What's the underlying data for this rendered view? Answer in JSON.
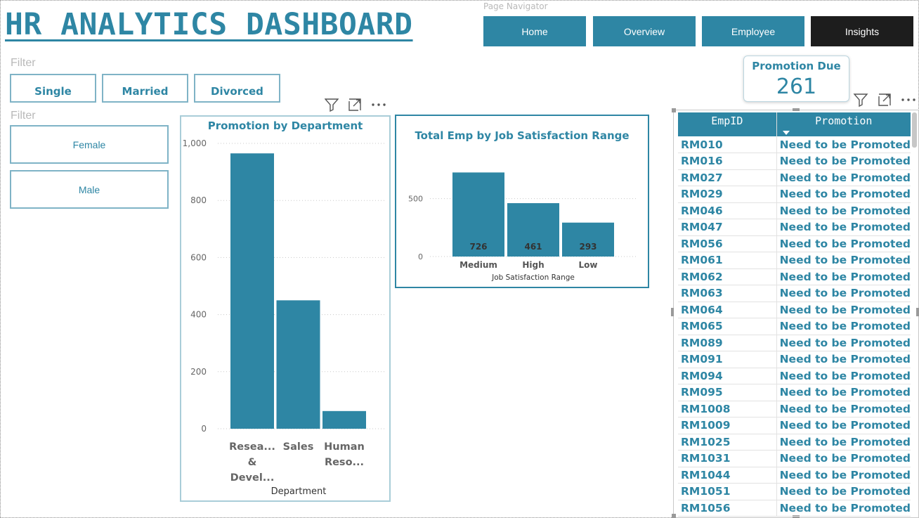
{
  "title": "HR ANALYTICS DASHBOARD",
  "navigator": {
    "label": "Page Navigator",
    "buttons": [
      "Home",
      "Overview",
      "Employee",
      "Insights"
    ],
    "active": "Insights"
  },
  "filters": {
    "marital_label": "Filter",
    "marital": [
      "Single",
      "Married",
      "Divorced"
    ],
    "gender_label": "Filter",
    "gender": [
      "Female",
      "Male"
    ]
  },
  "kpi": {
    "label": "Promotion Due",
    "value": "261"
  },
  "icons": [
    "filter-icon",
    "focus-mode-icon",
    "more-options-icon"
  ],
  "colors": {
    "accent": "#2e86a4",
    "active_nav": "#1d1d1d",
    "muted": "#b9b9b9"
  },
  "chart_data": [
    {
      "type": "bar",
      "title": "Promotion by Department",
      "xlabel": "Department",
      "ylabel": "",
      "categories": [
        [
          "Resea...",
          "&",
          "Devel..."
        ],
        [
          "Sales"
        ],
        [
          "Human",
          "Reso..."
        ]
      ],
      "values": [
        965,
        450,
        62
      ],
      "ylim": [
        0,
        1000
      ],
      "yticks": [
        "0",
        "200",
        "400",
        "600",
        "800",
        "1,000"
      ],
      "ytick_values": [
        0,
        200,
        400,
        600,
        800,
        1000
      ],
      "grid": true
    },
    {
      "type": "bar",
      "title": "Total Emp by Job Satisfaction Range",
      "xlabel": "Job Satisfaction Range",
      "ylabel": "",
      "categories": [
        "Medium",
        "High",
        "Low"
      ],
      "values": [
        726,
        461,
        293
      ],
      "data_labels": [
        "726",
        "461",
        "293"
      ],
      "ylim": [
        0,
        880
      ],
      "yticks": [
        "0",
        "500"
      ],
      "ytick_values": [
        0,
        500
      ],
      "grid": true
    }
  ],
  "table": {
    "columns": [
      "EmpID",
      "Promotion"
    ],
    "rows": [
      [
        "RM010",
        "Need to be Promoted"
      ],
      [
        "RM016",
        "Need to be Promoted"
      ],
      [
        "RM027",
        "Need to be Promoted"
      ],
      [
        "RM029",
        "Need to be Promoted"
      ],
      [
        "RM046",
        "Need to be Promoted"
      ],
      [
        "RM047",
        "Need to be Promoted"
      ],
      [
        "RM056",
        "Need to be Promoted"
      ],
      [
        "RM061",
        "Need to be Promoted"
      ],
      [
        "RM062",
        "Need to be Promoted"
      ],
      [
        "RM063",
        "Need to be Promoted"
      ],
      [
        "RM064",
        "Need to be Promoted"
      ],
      [
        "RM065",
        "Need to be Promoted"
      ],
      [
        "RM089",
        "Need to be Promoted"
      ],
      [
        "RM091",
        "Need to be Promoted"
      ],
      [
        "RM094",
        "Need to be Promoted"
      ],
      [
        "RM095",
        "Need to be Promoted"
      ],
      [
        "RM1008",
        "Need to be Promoted"
      ],
      [
        "RM1009",
        "Need to be Promoted"
      ],
      [
        "RM1025",
        "Need to be Promoted"
      ],
      [
        "RM1031",
        "Need to be Promoted"
      ],
      [
        "RM1044",
        "Need to be Promoted"
      ],
      [
        "RM1051",
        "Need to be Promoted"
      ],
      [
        "RM1056",
        "Need to be Promoted"
      ]
    ]
  }
}
